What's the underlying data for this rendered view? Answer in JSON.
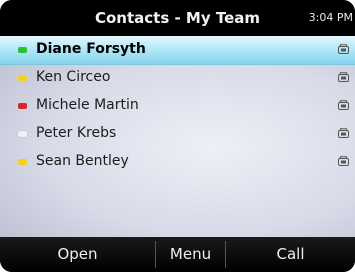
{
  "header": {
    "title": "Contacts - My Team",
    "time": "3:04 PM"
  },
  "contacts": [
    {
      "name": "Diane Forsyth",
      "status_color": "#2fbf2f",
      "selected": true
    },
    {
      "name": "Ken Circeo",
      "status_color": "#f2d21c",
      "selected": false
    },
    {
      "name": "Michele Martin",
      "status_color": "#d9262a",
      "selected": false
    },
    {
      "name": "Peter Krebs",
      "status_color": "#eef0f5",
      "selected": false
    },
    {
      "name": "Sean Bentley",
      "status_color": "#f2d21c",
      "selected": false
    }
  ],
  "call_icon": "phone-handset-icon",
  "softkeys": {
    "open": "Open",
    "menu": "Menu",
    "call": "Call"
  }
}
